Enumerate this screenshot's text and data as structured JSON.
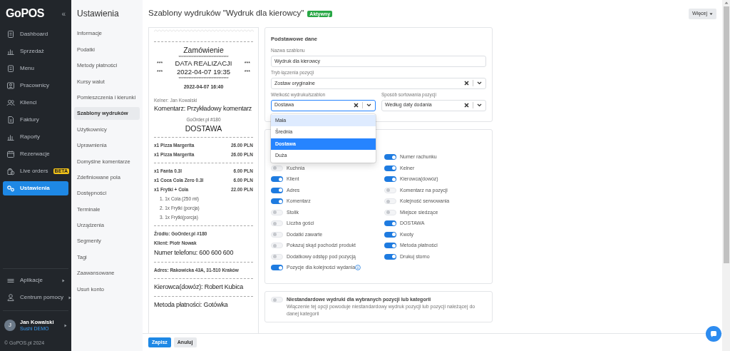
{
  "sidebar": {
    "logo": "GoPOS",
    "collapse": "«",
    "items": [
      {
        "label": "Dashboard",
        "selected": false
      },
      {
        "label": "Sprzedaż",
        "selected": false
      },
      {
        "label": "Menu",
        "selected": false
      },
      {
        "label": "Pracownicy",
        "selected": false
      },
      {
        "label": "Klienci",
        "selected": false
      },
      {
        "label": "Faktury",
        "selected": false
      },
      {
        "label": "Raporty",
        "selected": false
      },
      {
        "label": "Rezerwacje",
        "selected": false
      },
      {
        "label": "Live orders",
        "badge": "BETA",
        "selected": false
      },
      {
        "label": "Ustawienia",
        "selected": true
      }
    ],
    "bottom_items": [
      {
        "label": "Aplikacje"
      },
      {
        "label": "Centrum pomocy"
      }
    ],
    "user": {
      "initial": "J",
      "name": "Jan Kowalski",
      "company": "Sushi DEMO"
    },
    "copyright": "© GoPOS.pl 2024"
  },
  "settings_nav": {
    "title": "Ustawienia",
    "items": [
      {
        "label": "Informacje",
        "selected": false
      },
      {
        "label": "Podatki",
        "selected": false
      },
      {
        "label": "Metody płatności",
        "selected": false
      },
      {
        "label": "Kursy walut",
        "selected": false
      },
      {
        "label": "Pomieszczenia i kierunki",
        "selected": false
      },
      {
        "label": "Szablony wydruków",
        "selected": true
      },
      {
        "label": "Użytkownicy",
        "selected": false
      },
      {
        "label": "Uprawnienia",
        "selected": false
      },
      {
        "label": "Domyślne komentarze",
        "selected": false
      },
      {
        "label": "Zdefiniowane pola",
        "selected": false
      },
      {
        "label": "Dostępności",
        "selected": false
      },
      {
        "label": "Terminale",
        "selected": false
      },
      {
        "label": "Urządzenia",
        "selected": false
      },
      {
        "label": "Segmenty",
        "selected": false
      },
      {
        "label": "Tagi",
        "selected": false
      },
      {
        "label": "Zaawansowane",
        "selected": false
      },
      {
        "label": "Usuń konto",
        "selected": false
      }
    ]
  },
  "header": {
    "title": "Szablony wydruków \"Wydruk dla kierowcy\"",
    "badge": "Aktywny",
    "more_button": "Więcej"
  },
  "receipt": {
    "lines": [
      {
        "kind": "rule"
      },
      {
        "kind": "title",
        "text": "Zamówienie"
      },
      {
        "kind": "stars",
        "text": "******************************"
      },
      {
        "kind": "framed",
        "left": "***",
        "text": "DATA REALIZACJI",
        "right": "***"
      },
      {
        "kind": "framed",
        "left": "***",
        "text": "2022-04-07 19:35",
        "right": "***"
      },
      {
        "kind": "stars",
        "text": "******************************"
      },
      {
        "kind": "center-bold",
        "text": "2022-04-07 16:40"
      },
      {
        "kind": "small",
        "text": "Kelner: Jan Kowalski"
      },
      {
        "kind": "large",
        "text": "Komentarz: Przykładowy komentarz"
      },
      {
        "kind": "center-small",
        "text": "GoOrder.pl #180"
      },
      {
        "kind": "title",
        "text": "DOSTAWA"
      },
      {
        "kind": "rule"
      },
      {
        "kind": "item",
        "text": "x1 Pizza Margerita",
        "price": "26.00 PLN"
      },
      {
        "kind": "item",
        "text": "x1 Pizza Margerita",
        "price": "26.00 PLN"
      },
      {
        "kind": "rule"
      },
      {
        "kind": "item",
        "text": "x1 Fanta 0.3l",
        "price": "6.00 PLN"
      },
      {
        "kind": "item",
        "text": "x1 Coca Cola Zero 0.3l",
        "price": "6.00 PLN"
      },
      {
        "kind": "item",
        "text": "x1 Frytki + Cola",
        "price": "22.00 PLN"
      },
      {
        "kind": "sub",
        "text": "1. 1x Cola (250 ml)"
      },
      {
        "kind": "sub",
        "text": "2. 1x Frytki (porcja)"
      },
      {
        "kind": "sub",
        "text": "3. 1x Frytki(porcja)"
      },
      {
        "kind": "rule"
      },
      {
        "kind": "bold",
        "text": "Źródło: GoOrder.pl #180"
      },
      {
        "kind": "bold",
        "text": "Klient: Piotr Nowak"
      },
      {
        "kind": "large",
        "text": "Numer telefonu: 600 600 600"
      },
      {
        "kind": "rule"
      },
      {
        "kind": "bold",
        "text": "Adres: Rakowicka 43A, 31-510 Kraków"
      },
      {
        "kind": "rule"
      },
      {
        "kind": "large",
        "text": "Kierowca(dowóz): Robert Kubica"
      },
      {
        "kind": "rule"
      },
      {
        "kind": "large",
        "text": "Metoda płatności: Gotówka"
      }
    ]
  },
  "basic_data": {
    "title": "Podstawowe dane",
    "name_field": {
      "label": "Nazwa szablonu",
      "value": "Wydruk dla kierowcy"
    },
    "mode_select": {
      "label": "Tryb łączenia pozycji",
      "value": "Zostaw oryginalne"
    },
    "size_select": {
      "label": "Wielkość wydruku/szablon",
      "value": "Dostawa",
      "expanded": true,
      "options": [
        {
          "label": "Mała",
          "highlighted": true,
          "selected": false
        },
        {
          "label": "Średnia",
          "selected": false
        },
        {
          "label": "Dostawa",
          "selected": true
        },
        {
          "label": "Duża",
          "selected": false
        }
      ]
    },
    "sort_select": {
      "label": "Sposób sortowania pozycji",
      "value": "Według daty dodania"
    }
  },
  "print_options": {
    "left": [
      {
        "label": "Kuchnia",
        "on": false
      },
      {
        "label": "Klient",
        "on": true
      },
      {
        "label": "Adres",
        "on": true
      },
      {
        "label": "Komentarz",
        "on": true
      },
      {
        "label": "Stolik",
        "on": false
      },
      {
        "label": "Liczba gości",
        "on": false
      },
      {
        "label": "Dodatki zawarte",
        "on": false
      },
      {
        "label": "Pokazuj skąd pochodzi produkt",
        "on": false
      },
      {
        "label": "Dodatkowy odstęp pod pozycją",
        "on": false
      },
      {
        "label": "Pozycje dla kolejności wydania",
        "on": true,
        "info": true
      }
    ],
    "right": [
      {
        "label": "Numer rachunku",
        "on": true
      },
      {
        "label": "Kelner",
        "on": true
      },
      {
        "label": "Kierowca(dowóz)",
        "on": true
      },
      {
        "label": "Komentarz na pozycji",
        "on": false
      },
      {
        "label": "Kolejność serwowania",
        "on": false
      },
      {
        "label": "Miejsce siedzące",
        "on": false
      },
      {
        "label": "DOSTAWA",
        "on": true
      },
      {
        "label": "Kwoty",
        "on": true
      },
      {
        "label": "Metoda płatności",
        "on": true
      },
      {
        "label": "Drukuj storno",
        "on": true
      }
    ]
  },
  "custom_prints": {
    "on": false,
    "title": "Niestandardowe wydruki dla wybranych pozycji lub kategorii",
    "description": "Włączenie tej opcji powoduje niestandardowy wydruk pozycji lub pozycji należącej do danej kategorii"
  },
  "footer": {
    "save": "Zapisz",
    "cancel": "Anuluj"
  }
}
